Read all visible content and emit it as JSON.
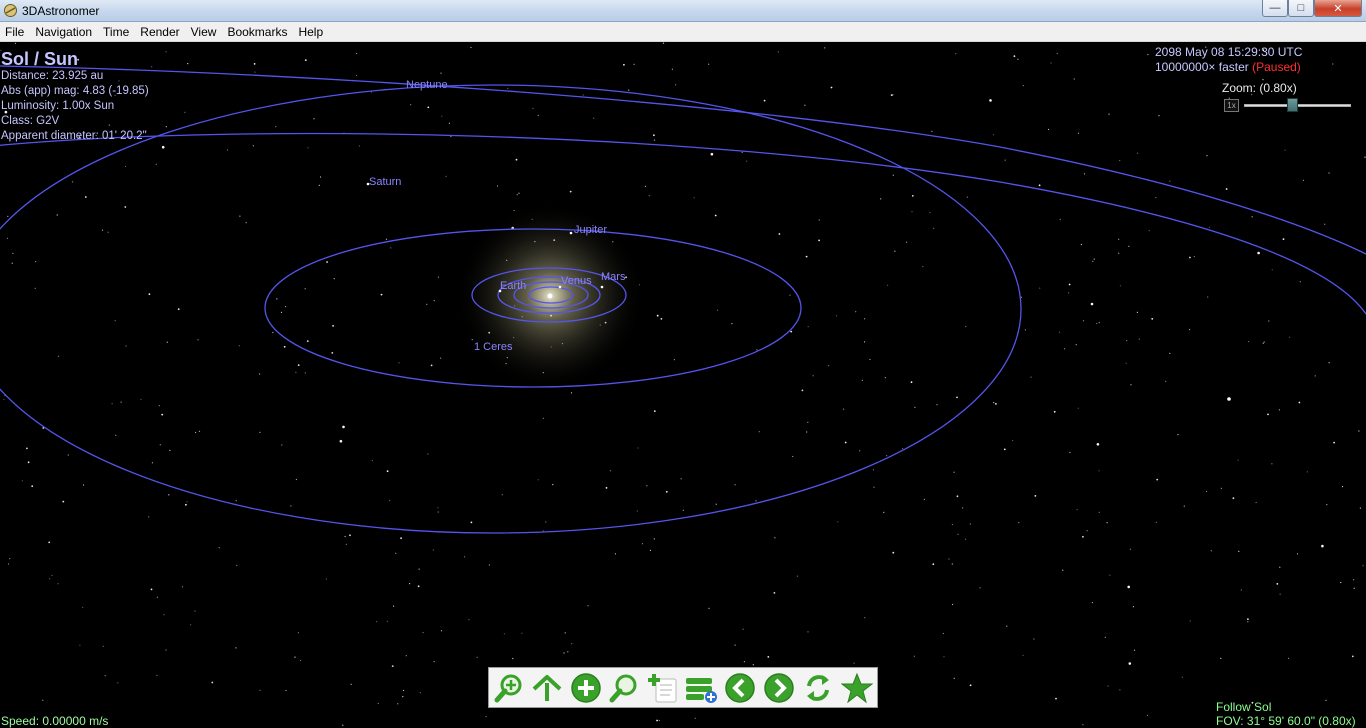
{
  "window": {
    "title": "3DAstronomer",
    "controls": {
      "minimize": "—",
      "maximize": "□",
      "close": "✕"
    }
  },
  "menu": [
    "File",
    "Navigation",
    "Time",
    "Render",
    "View",
    "Bookmarks",
    "Help"
  ],
  "info": {
    "title": "Sol / Sun",
    "distance": "Distance: 23.925 au",
    "abs_mag": "Abs (app) mag: 4.83 (-19.85)",
    "luminosity": "Luminosity: 1.00x Sun",
    "class": "Class: G2V",
    "apparent_diameter": "Apparent diameter: 01' 20.2\""
  },
  "time": {
    "datetime": "2098 May 08 15:29:30 UTC",
    "rate": "10000000× faster",
    "status": "(Paused)"
  },
  "zoom": {
    "label": "Zoom: (0.80x)",
    "reset": "1x",
    "level": 0.45
  },
  "planets": [
    {
      "name": "Neptune"
    },
    {
      "name": "Saturn"
    },
    {
      "name": "Jupiter"
    },
    {
      "name": "Mars"
    },
    {
      "name": "Venus"
    },
    {
      "name": "Earth"
    },
    {
      "name": "1 Ceres"
    }
  ],
  "toolbar": [
    {
      "icon": "zoom-in-icon"
    },
    {
      "icon": "home-arrow-icon"
    },
    {
      "icon": "plus-icon"
    },
    {
      "icon": "search-icon"
    },
    {
      "icon": "add-document-icon"
    },
    {
      "icon": "add-list-icon"
    },
    {
      "icon": "back-icon"
    },
    {
      "icon": "forward-icon"
    },
    {
      "icon": "refresh-icon"
    },
    {
      "icon": "star-icon"
    }
  ],
  "status": {
    "speed": "Speed: 0.00000 m/s",
    "follow": "Follow Sol",
    "fov": "FOV: 31° 59' 60.0\" (0.80x)"
  },
  "colors": {
    "orbit": "#5555ee",
    "label": "#8a84ff",
    "info_text": "#c5c5ff",
    "status_text": "#8dff8d",
    "paused": "#ff3030",
    "toolbar_icon": "#3aa12a"
  }
}
